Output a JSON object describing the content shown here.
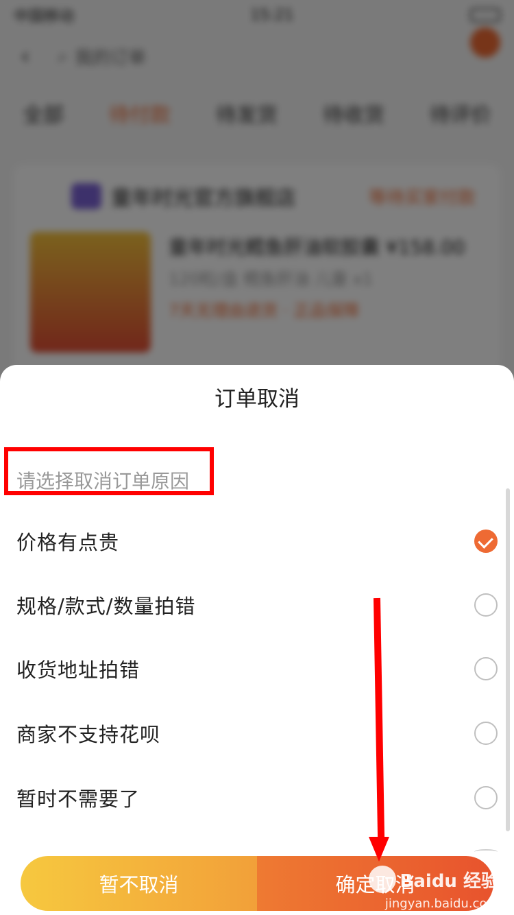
{
  "background": {
    "status_carrier": "中国移动",
    "status_time": "15:21",
    "nav_title": "我的订单",
    "tabs": [
      "全部",
      "待付款",
      "待发货",
      "待收货",
      "待评价"
    ],
    "shop_name": "童年时光官方旗舰店",
    "order_status": "等待买家付款",
    "goods_title": "童年时光鳕鱼肝油软胶囊",
    "goods_price": "¥158.00",
    "goods_sub": "120粒/盒 鳕鱼肝油 儿童",
    "goods_qty": "x1",
    "goods_tag": "7天无理由退货 · 正品保障"
  },
  "sheet": {
    "title": "订单取消",
    "prompt": "请选择取消订单原因",
    "reasons": [
      {
        "label": "价格有点贵",
        "checked": true
      },
      {
        "label": "规格/款式/数量拍错",
        "checked": false
      },
      {
        "label": "收货地址拍错",
        "checked": false
      },
      {
        "label": "商家不支持花呗",
        "checked": false
      },
      {
        "label": "暂时不需要了",
        "checked": false
      }
    ],
    "keep_button": "暂不取消",
    "confirm_button": "确定取消"
  },
  "watermark": {
    "brand": "Baidu 经验",
    "url": "jingyan.baidu.com"
  },
  "colors": {
    "accent": "#ee6a33",
    "annotation": "#ff0000"
  }
}
